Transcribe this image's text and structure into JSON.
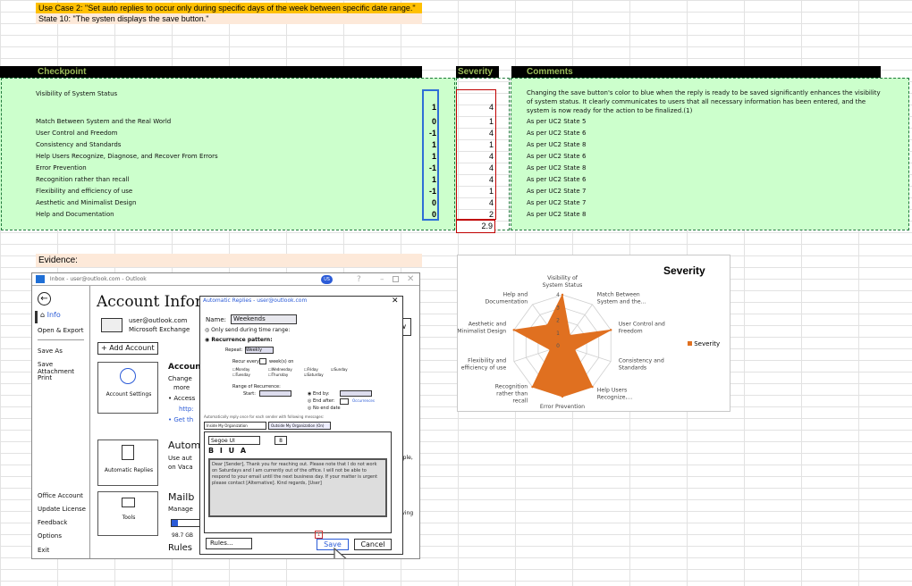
{
  "use_case_line": "Use Case 2: \"Set auto replies to occur only during specific days of the week between specific date range.\"",
  "state_line": "State 10: \"The systen displays the save button.\"",
  "headers": {
    "checkpoint": "Checkpoint",
    "severity": "Severity",
    "comments": "Comments"
  },
  "rows": [
    {
      "label": "Visibility of System Status",
      "check": "1",
      "severity": "4",
      "comment": "Changing the save button's color to blue when the reply is ready to be saved significantly enhances the visibility of system status. It clearly communicates to users that all necessary information has been entered, and the system is now ready for the action to be finalized.(1)"
    },
    {
      "label": "Match Between System and the Real World",
      "check": "0",
      "severity": "1",
      "comment": "As per UC2 State 5"
    },
    {
      "label": "User Control and Freedom",
      "check": "-1",
      "severity": "4",
      "comment": "As per UC2 State 6"
    },
    {
      "label": "Consistency and Standards",
      "check": "1",
      "severity": "1",
      "comment": "As per UC2 State 8"
    },
    {
      "label": "Help Users Recognize, Diagnose, and Recover From Errors",
      "check": "1",
      "severity": "4",
      "comment": "As per UC2 State 6"
    },
    {
      "label": "Error Prevention",
      "check": "-1",
      "severity": "4",
      "comment": "As per UC2 State 8"
    },
    {
      "label": "Recognition rather than recall",
      "check": "1",
      "severity": "4",
      "comment": "As per UC2 State 6"
    },
    {
      "label": "Flexibility and efficiency of use",
      "check": "-1",
      "severity": "1",
      "comment": "As per UC2 State 7"
    },
    {
      "label": "Aesthetic and Minimalist Design",
      "check": "0",
      "severity": "4",
      "comment": "As per UC2 State 7"
    },
    {
      "label": "Help and Documentation",
      "check": "0",
      "severity": "2",
      "comment": "As per UC2 State 8"
    }
  ],
  "average": "2.9",
  "evidence_label": "Evidence:",
  "colors": {
    "header_bg": "#000000",
    "header_text": "#9bbb59",
    "band": "#ccffcc",
    "accent": "#ffc000",
    "chart_fill": "#e07020"
  },
  "chart_data": {
    "type": "radar",
    "title": "Severity",
    "categories": [
      "Visibility of System Status",
      "Match Between System and the...",
      "User Control and Freedom",
      "Consistency and Standards",
      "Help Users Recognize,...",
      "Error Prevention",
      "Recognition rather than recall",
      "Flexibility and efficiency of use",
      "Aesthetic and Minimalist Design",
      "Help and Documentation"
    ],
    "series": [
      {
        "name": "Severity",
        "values": [
          4,
          1,
          4,
          1,
          4,
          4,
          4,
          1,
          4,
          2
        ]
      }
    ],
    "rlim": [
      0,
      4
    ],
    "tick_labels": [
      "0",
      "1",
      "2",
      "3",
      "4"
    ],
    "legend": "right"
  },
  "sketch": {
    "titlebar": "Inbox - user@outlook.com - Outlook",
    "avatar": "US",
    "back_icon": "back-arrow-icon",
    "info": "Info",
    "open_export": "Open & Export",
    "save_as": "Save As",
    "save_attachment": "Save Attachment",
    "print": "Print",
    "office_account": "Office Account",
    "update_license": "Update License",
    "feedback": "Feedback",
    "options": "Options",
    "exit": "Exit",
    "account_info": "Account Informa",
    "account_email": "user@outlook.com",
    "account_type": "Microsoft Exchange",
    "add_account": "+ Add Account",
    "account_settings": "Account Settings",
    "account_heading": "Accoun",
    "change": "Change",
    "more": "more",
    "access": "• Access",
    "http": "http:",
    "get": "• Get th",
    "automatic_replies": "Automatic Replies",
    "auto_heading": "Autom",
    "use_auto": "Use aut",
    "on_vaca": "on Vaca",
    "tools": "Tools",
    "mailbox": "Mailb",
    "manage": "Manage",
    "storage": "98.7 GB",
    "rules": "Rules",
    "trail1": "ople,",
    "trail2": "eaving"
  },
  "dialog": {
    "title": "Automatic Replies - user@outlook.com",
    "name_label": "Name:",
    "name_value": "Weekends",
    "only_send": "Only send during time range:",
    "recurrence": "Recurrence pattern:",
    "repeat": "Repeat:",
    "repeat_value": "Weekly",
    "recur_every": "Recur every",
    "weeks_on": "week(s) on",
    "days": [
      "Monday",
      "Tuesday",
      "Wednesday",
      "Thursday",
      "Friday",
      "Saturday",
      "Sunday"
    ],
    "range": "Range of Recurrence:",
    "start": "Start:",
    "end_by": "End by:",
    "end_after": "End after:",
    "occurrences": "Occurrences",
    "no_end": "No end date",
    "hint": "Automatically reply once for each sender with following messages:",
    "tab_inside": "Inside My Organization",
    "tab_outside": "Outside My Organization (On)",
    "font_name": "Segoe UI",
    "font_size": "8",
    "format_buttons": "B I U A",
    "message": "Dear [Sender], Thank you for reaching out. Please note that I do not work on Saturdays and I am currently out of the office. I will not be able to respond to your email until the next business day. If your matter is urgent please contact [Alternative]. Kind regards, [User]",
    "rules_button": "Rules...",
    "save_button": "Save",
    "cancel_button": "Cancel",
    "marker": "1"
  }
}
